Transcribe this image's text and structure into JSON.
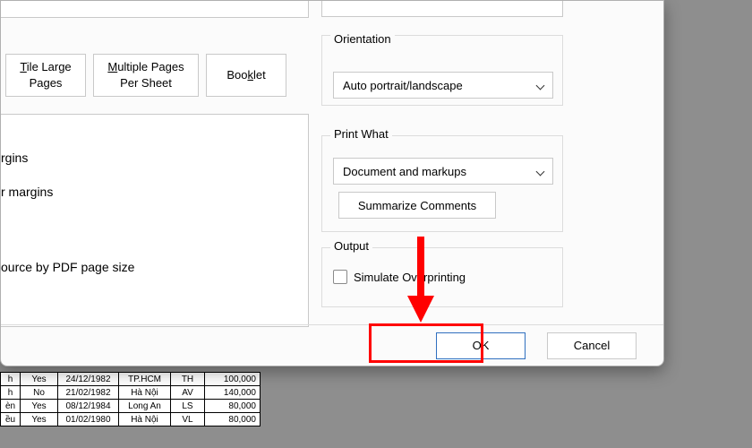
{
  "tiles": {
    "tile_large_pages": "Tile Large\nPages",
    "multiple_pages": "Multiple Pages\nPer Sheet",
    "booklet": "Booklet"
  },
  "left_panel": {
    "line1": "rgins",
    "line2": "r margins",
    "line3": "ource by PDF page size"
  },
  "orientation": {
    "label": "Orientation",
    "value": "Auto portrait/landscape"
  },
  "print_what": {
    "label": "Print What",
    "value": "Document and markups",
    "summarize_label": "Summarize Comments"
  },
  "output": {
    "label": "Output",
    "checkbox_label": "Simulate Overprinting"
  },
  "actions": {
    "ok": "OK",
    "cancel": "Cancel"
  },
  "table_rows": [
    {
      "c1": "h",
      "c2": "Yes",
      "c3": "24/12/1982",
      "c4": "TP.HCM",
      "c5": "TH",
      "c6": "100,000"
    },
    {
      "c1": "h",
      "c2": "No",
      "c3": "21/02/1982",
      "c4": "Hà Nội",
      "c5": "AV",
      "c6": "140,000"
    },
    {
      "c1": "èn",
      "c2": "Yes",
      "c3": "08/12/1984",
      "c4": "Long An",
      "c5": "LS",
      "c6": "80,000"
    },
    {
      "c1": "ều",
      "c2": "Yes",
      "c3": "01/02/1980",
      "c4": "Hà Nội",
      "c5": "VL",
      "c6": "80,000"
    }
  ]
}
